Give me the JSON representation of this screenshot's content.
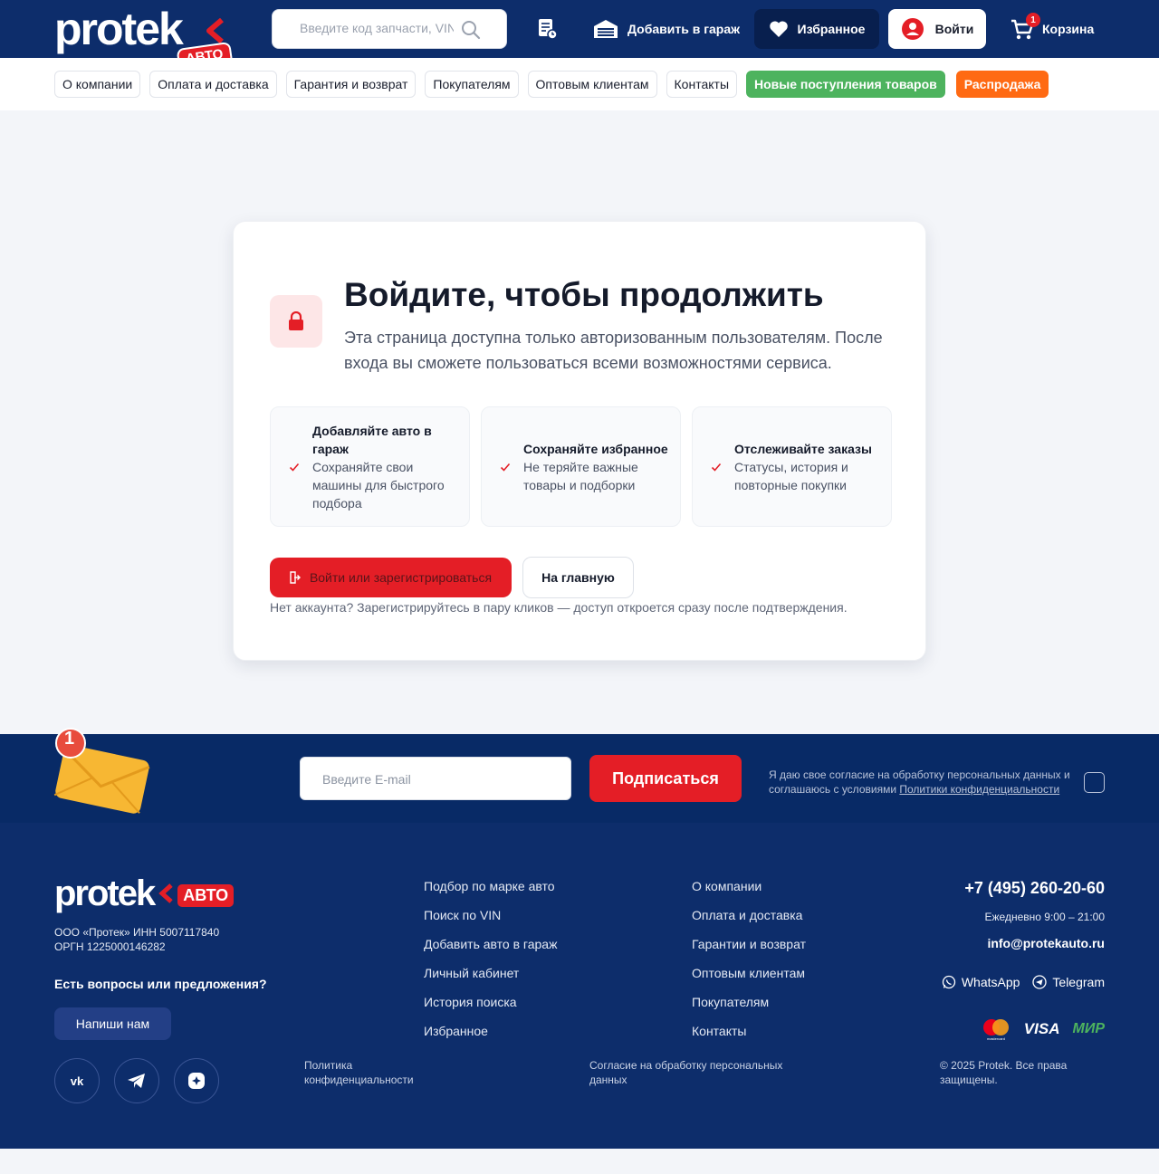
{
  "header": {
    "logo_text": "protek",
    "logo_badge": "АВТО",
    "search_placeholder": "Введите код запчасти, VIN",
    "add_garage": "Добавить в гараж",
    "favorites": "Избранное",
    "login": "Войти",
    "cart": "Корзина",
    "cart_count": "1"
  },
  "nav": {
    "items": [
      "О компании",
      "Оплата и доставка",
      "Гарантия и возврат",
      "Покупателям",
      "Оптовым клиентам",
      "Контакты"
    ],
    "new_arrivals": "Новые поступления товаров",
    "sale": "Распродажа"
  },
  "card": {
    "title": "Войдите, чтобы продолжить",
    "subtitle": "Эта страница доступна только авторизованным пользователям. После входа вы сможете пользоваться всеми возможностями сервиса.",
    "features": [
      {
        "title": "Добавляйте авто в гараж",
        "desc": "Сохраняйте свои машины для быстрого подбора"
      },
      {
        "title": "Сохраняйте избранное",
        "desc": "Не теряйте важные товары и подборки"
      },
      {
        "title": "Отслеживайте заказы",
        "desc": "Статусы, история и повторные покупки"
      }
    ],
    "primary_button": "Войти или зарегистрироваться",
    "secondary_button": "На главную",
    "note": "Нет аккаунта? Зарегистрируйтесь в пару кликов — доступ откроется сразу после подтверждения."
  },
  "subscribe": {
    "envelope_badge": "1",
    "email_placeholder": "Введите E-mail",
    "button": "Подписаться",
    "consent_text": "Я даю свое согласие на обработку персональных данных и соглашаюсь с условиями",
    "consent_link": "Политики конфиденциальности"
  },
  "footer": {
    "logo_text": "protek",
    "logo_badge": "АВТО",
    "company_line1": "ООО «Протек» ИНН 5007117840",
    "company_line2": "ОРГН 1225000146282",
    "question": "Есть вопросы или предложения?",
    "write_button": "Напиши нам",
    "col1": [
      "Подбор по марке авто",
      "Поиск по VIN",
      "Добавить авто в гараж",
      "Личный кабинет",
      "История поиска",
      "Избранное"
    ],
    "col2": [
      "О компании",
      "Оплата и доставка",
      "Гарантии и возврат",
      "Оптовым клиентам",
      "Покупателям",
      "Контакты"
    ],
    "phone": "+7 (495) 260-20-60",
    "hours": "Ежедневно 9:00 – 21:00",
    "email": "info@protekauto.ru",
    "whatsapp": "WhatsApp",
    "telegram": "Telegram",
    "payment_icons": [
      "mastercard-icon",
      "visa-icon",
      "mir-icon"
    ],
    "visa_text": "VISA",
    "mir_text": "МИР",
    "mastercard_text": "mastercard",
    "privacy": "Политика конфиденциальности",
    "consent": "Согласие на обработку персональных данных",
    "copyright": "© 2025 Protek. Все права защищены."
  },
  "colors": {
    "primary_blue": "#0d2d6b",
    "brand_red": "#e41e26",
    "green": "#4db35e",
    "orange": "#ff6a13"
  }
}
